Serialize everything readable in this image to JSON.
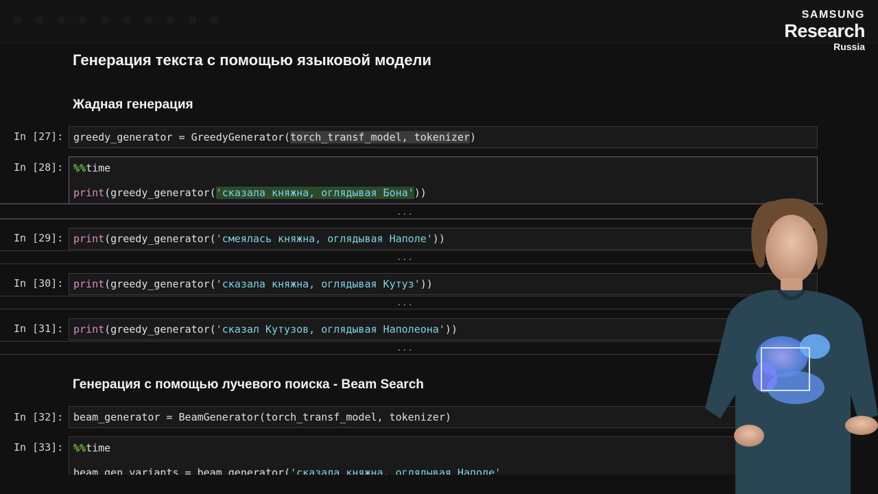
{
  "logo": {
    "line1": "SAMSUNG",
    "line2": "Research",
    "line3": "Russia"
  },
  "headings": {
    "main": "Генерация текста с помощью языковой модели",
    "greedy": "Жадная генерация",
    "beam": "Генерация с помощью лучевого поиска - Beam Search"
  },
  "cells": [
    {
      "prompt": "In [27]:",
      "parts": [
        "greedy_generator = GreedyGenerator(",
        "torch_transf_model, tokenizer",
        ")"
      ]
    },
    {
      "prompt": "In [28]:",
      "magic_pre": "%%",
      "magic": "time",
      "kw": "print",
      "mid": "(greedy_generator(",
      "str": "'сказала княжна, оглядывая Бона'",
      "end": "))"
    },
    {
      "prompt": "In [29]:",
      "kw": "print",
      "mid": "(greedy_generator(",
      "str": "'смеялась княжна, оглядывая Наполе'",
      "end": "))"
    },
    {
      "prompt": "In [30]:",
      "kw": "print",
      "mid": "(greedy_generator(",
      "str": "'сказала княжна, оглядывая Кутуз'",
      "end": "))"
    },
    {
      "prompt": "In [31]:",
      "kw": "print",
      "mid": "(greedy_generator(",
      "str": "'сказал Кутузов, оглядывая Наполеона'",
      "end": "))"
    },
    {
      "prompt": "In [32]:",
      "text": "beam_generator = BeamGenerator(torch_transf_model, tokenizer)"
    },
    {
      "prompt": "In [33]:",
      "magic_pre": "%%",
      "magic": "time",
      "line2_pre": "beam_gen_variants = beam_generator(",
      "line2_str": "'сказала княжна, оглядывая Наполе'"
    }
  ],
  "ellipsis": "..."
}
